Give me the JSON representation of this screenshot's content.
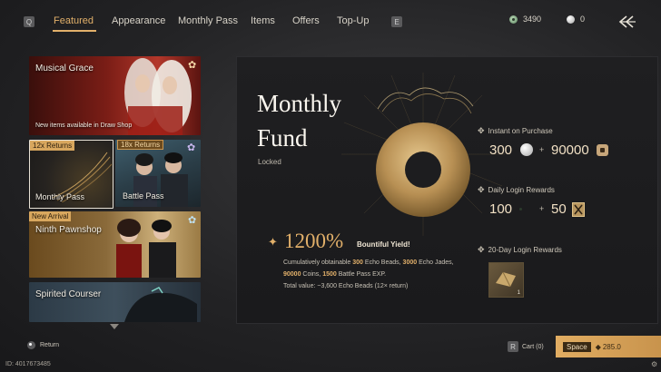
{
  "nav": {
    "left_key": "Q",
    "tabs": [
      {
        "label": "Featured",
        "active": true
      },
      {
        "label": "Appearance",
        "active": false
      },
      {
        "label": "Monthly Pass",
        "active": false
      },
      {
        "label": "Items",
        "active": false
      },
      {
        "label": "Offers",
        "active": false
      },
      {
        "label": "Top-Up",
        "active": false
      }
    ],
    "right_key": "E"
  },
  "currencies": {
    "jade": {
      "value": "3490",
      "icon": "jade-coin-icon"
    },
    "pearl": {
      "value": "0",
      "icon": "pearl-icon"
    }
  },
  "sidebar": {
    "musical_grace": {
      "title": "Musical Grace",
      "subtitle": "New items available in Draw Shop"
    },
    "monthly_pass": {
      "badge": "12x Returns",
      "title": "Monthly Pass"
    },
    "battle_pass": {
      "badge": "18x Returns",
      "title": "Battle Pass"
    },
    "pawnshop": {
      "badge": "New Arrival",
      "title": "Ninth Pawnshop"
    },
    "courser": {
      "title": "Spirited Courser"
    }
  },
  "fund": {
    "title_line1": "Monthly",
    "title_line2": "Fund",
    "status": "Locked",
    "multiplier": "1200%",
    "multiplier_label": "Bountiful Yield!",
    "desc_prefix": "Cumulatively obtainable ",
    "desc_v1": "300",
    "desc_t1": " Echo Beads, ",
    "desc_v2": "3000",
    "desc_t2": " Echo Jades, ",
    "desc_v3": "90000",
    "desc_t3": " Coins, ",
    "desc_v4": "1500",
    "desc_t4": " Battle Pass EXP.",
    "desc_total": "Total value: ~3,600 Echo Beads (12× return)"
  },
  "rewards": {
    "instant_label": "Instant on Purchase",
    "instant_a": "300",
    "instant_b": "90000",
    "daily_label": "Daily Login Rewards",
    "daily_a": "100",
    "daily_b": "50",
    "login20_label": "20-Day Login Rewards",
    "login20_count": "1",
    "plus": "+"
  },
  "footer": {
    "return_label": "Return",
    "cart_key": "R",
    "cart_label": "Cart (0)",
    "space_key": "Space",
    "space_price": "285.0",
    "player_id": "ID: 4017673485"
  },
  "colors": {
    "accent": "#e2b06a",
    "panel": "#1c1c1e"
  }
}
